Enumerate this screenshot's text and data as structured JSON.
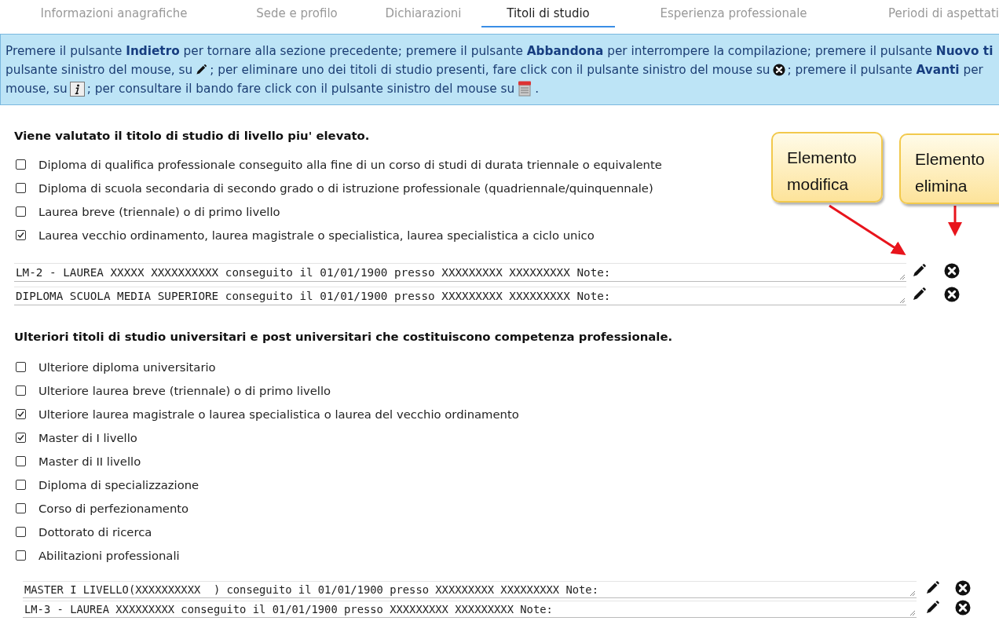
{
  "tabs": [
    {
      "label": "Informazioni anagrafiche",
      "selected": false
    },
    {
      "label": "Sede e profilo",
      "selected": false
    },
    {
      "label": "Dichiarazioni",
      "selected": false
    },
    {
      "label": "Titoli di studio",
      "selected": true
    },
    {
      "label": "Esperienza professionale",
      "selected": false
    },
    {
      "label": "Periodi di aspettati",
      "selected": false
    }
  ],
  "instructions": [
    [
      {
        "kind": "text",
        "text": "Premere il pulsante **Indietro** per tornare alla sezione precedente; premere il pulsante **Abbandona** per interrompere la compilazione; premere il pulsante **Nuovo ti**"
      }
    ],
    [
      {
        "kind": "text",
        "text": "pulsante sinistro del mouse, su"
      },
      {
        "kind": "pencil"
      },
      {
        "kind": "text",
        "text": "; per eliminare uno dei titoli di studio presenti, fare click con il pulsante sinistro del mouse su"
      },
      {
        "kind": "remove"
      },
      {
        "kind": "text",
        "text": "; premere il pulsante **Avanti** per"
      }
    ],
    [
      {
        "kind": "text",
        "text": "mouse, su"
      },
      {
        "kind": "info"
      },
      {
        "kind": "text",
        "text": "; per consultare il bando fare click con il pulsante sinistro del mouse su"
      },
      {
        "kind": "notice"
      },
      {
        "kind": "text",
        "text": "."
      }
    ]
  ],
  "sections": [
    {
      "heading": "Viene valutato il titolo di studio di livello piu' elevato.",
      "options": [
        {
          "label": "Diploma di qualifica professionale conseguito alla fine di un corso di studi di durata triennale o equivalente",
          "checked": false
        },
        {
          "label": "Diploma di scuola secondaria di secondo grado o di istruzione professionale (quadriennale/quinquennale)",
          "checked": false
        },
        {
          "label": "Laurea breve (triennale) o di primo livello",
          "checked": false
        },
        {
          "label": "Laurea vecchio ordinamento, laurea magistrale o specialistica, laurea specialistica a ciclo unico",
          "checked": true
        }
      ],
      "entries": [
        "LM-2 - LAUREA XXXXX XXXXXXXXXX conseguito il 01/01/1900 presso XXXXXXXXX XXXXXXXXX Note:",
        "DIPLOMA SCUOLA MEDIA SUPERIORE conseguito il 01/01/1900 presso XXXXXXXXX XXXXXXXXX Note:"
      ]
    },
    {
      "heading": "Ulteriori titoli di studio universitari e post universitari che costituiscono competenza professionale.",
      "options": [
        {
          "label": "Ulteriore diploma universitario",
          "checked": false
        },
        {
          "label": "Ulteriore laurea breve (triennale) o di primo livello",
          "checked": false
        },
        {
          "label": "Ulteriore laurea magistrale o laurea specialistica o laurea del vecchio ordinamento",
          "checked": true
        },
        {
          "label": "Master di I livello",
          "checked": true
        },
        {
          "label": "Master di II livello",
          "checked": false
        },
        {
          "label": "Diploma di specializzazione",
          "checked": false
        },
        {
          "label": "Corso di perfezionamento",
          "checked": false
        },
        {
          "label": "Dottorato di ricerca",
          "checked": false
        },
        {
          "label": "Abilitazioni professionali",
          "checked": false
        }
      ],
      "entries": [
        "MASTER I LIVELLO(XXXXXXXXXX  ) conseguito il 01/01/1900 presso XXXXXXXXX XXXXXXXXX Note:",
        "LM-3 - LAUREA XXXXXXXXX conseguito il 01/01/1900 presso XXXXXXXXX XXXXXXXXX Note:"
      ]
    }
  ],
  "callouts": [
    {
      "text": "Elemento modifica"
    },
    {
      "text": "Elemento elimina"
    }
  ]
}
